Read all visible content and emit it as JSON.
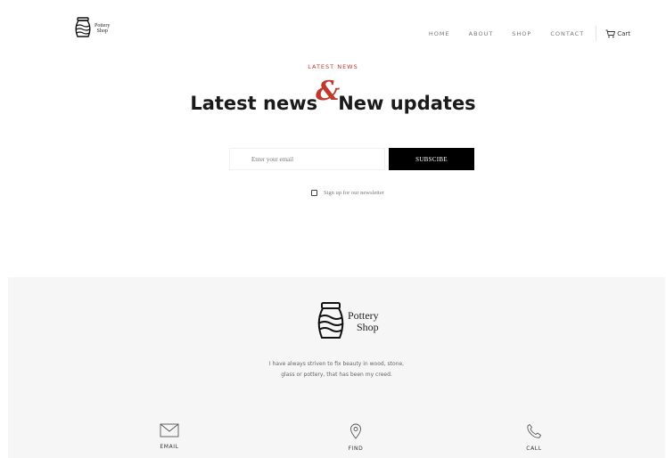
{
  "brand": {
    "line1": "Pottery",
    "line2": "Shop"
  },
  "nav": {
    "items": [
      "HOME",
      "ABOUT",
      "SHOP",
      "CONTACT"
    ],
    "cart_label": "Cart"
  },
  "hero": {
    "eyebrow": "LATEST NEWS",
    "title_left": "Latest news",
    "title_amp": "&",
    "title_right": "New updates"
  },
  "subscribe": {
    "email_placeholder": "Enter your email",
    "button_label": "SUBSCIBE",
    "newsletter_label": "Sign up for our newsletter",
    "newsletter_checked": false
  },
  "footer": {
    "brand": {
      "line1": "Pottery",
      "line2": "Shop"
    },
    "tagline_line1": "I have always striven to fix beauty in wood, stone,",
    "tagline_line2": "glass or pottery, that has been my creed.",
    "contacts": [
      {
        "label": "EMAIL",
        "icon": "envelope-icon"
      },
      {
        "label": "FIND",
        "icon": "location-pin-icon"
      },
      {
        "label": "CALL",
        "icon": "phone-icon"
      }
    ]
  },
  "colors": {
    "accent": "#c0392b",
    "button_bg": "#000000",
    "footer_bg": "#f6f6f6"
  }
}
